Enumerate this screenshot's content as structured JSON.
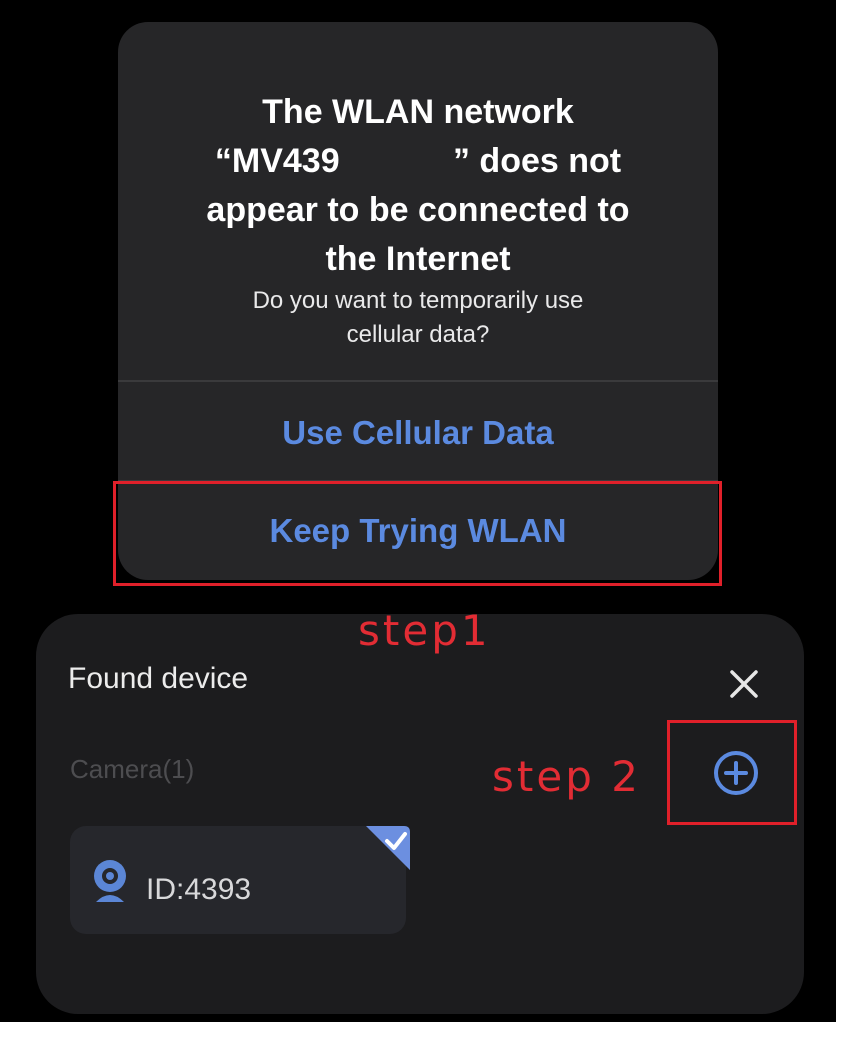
{
  "alert": {
    "title_lines": [
      "The WLAN network",
      "“MV439            ” does not",
      "appear to be connected to",
      "the Internet"
    ],
    "message_lines": [
      "Do you want to temporarily use",
      "cellular data?"
    ],
    "buttons": {
      "use_cellular": "Use Cellular Data",
      "keep_trying": "Keep Trying WLAN"
    }
  },
  "annotations": {
    "step1": "step1",
    "step2": "step 2"
  },
  "sheet": {
    "title": "Found device",
    "section_label": "Camera(1)",
    "device": {
      "id_text": "ID:4393",
      "icon": "camera-icon",
      "selected": true
    },
    "close_icon": "close-icon",
    "add_icon": "add-circle-icon"
  },
  "colors": {
    "background": "#000000",
    "alert_bg": "#262628",
    "sheet_bg": "#1c1c1e",
    "accent": "#5b8ae0",
    "annotation": "#e0202a"
  }
}
